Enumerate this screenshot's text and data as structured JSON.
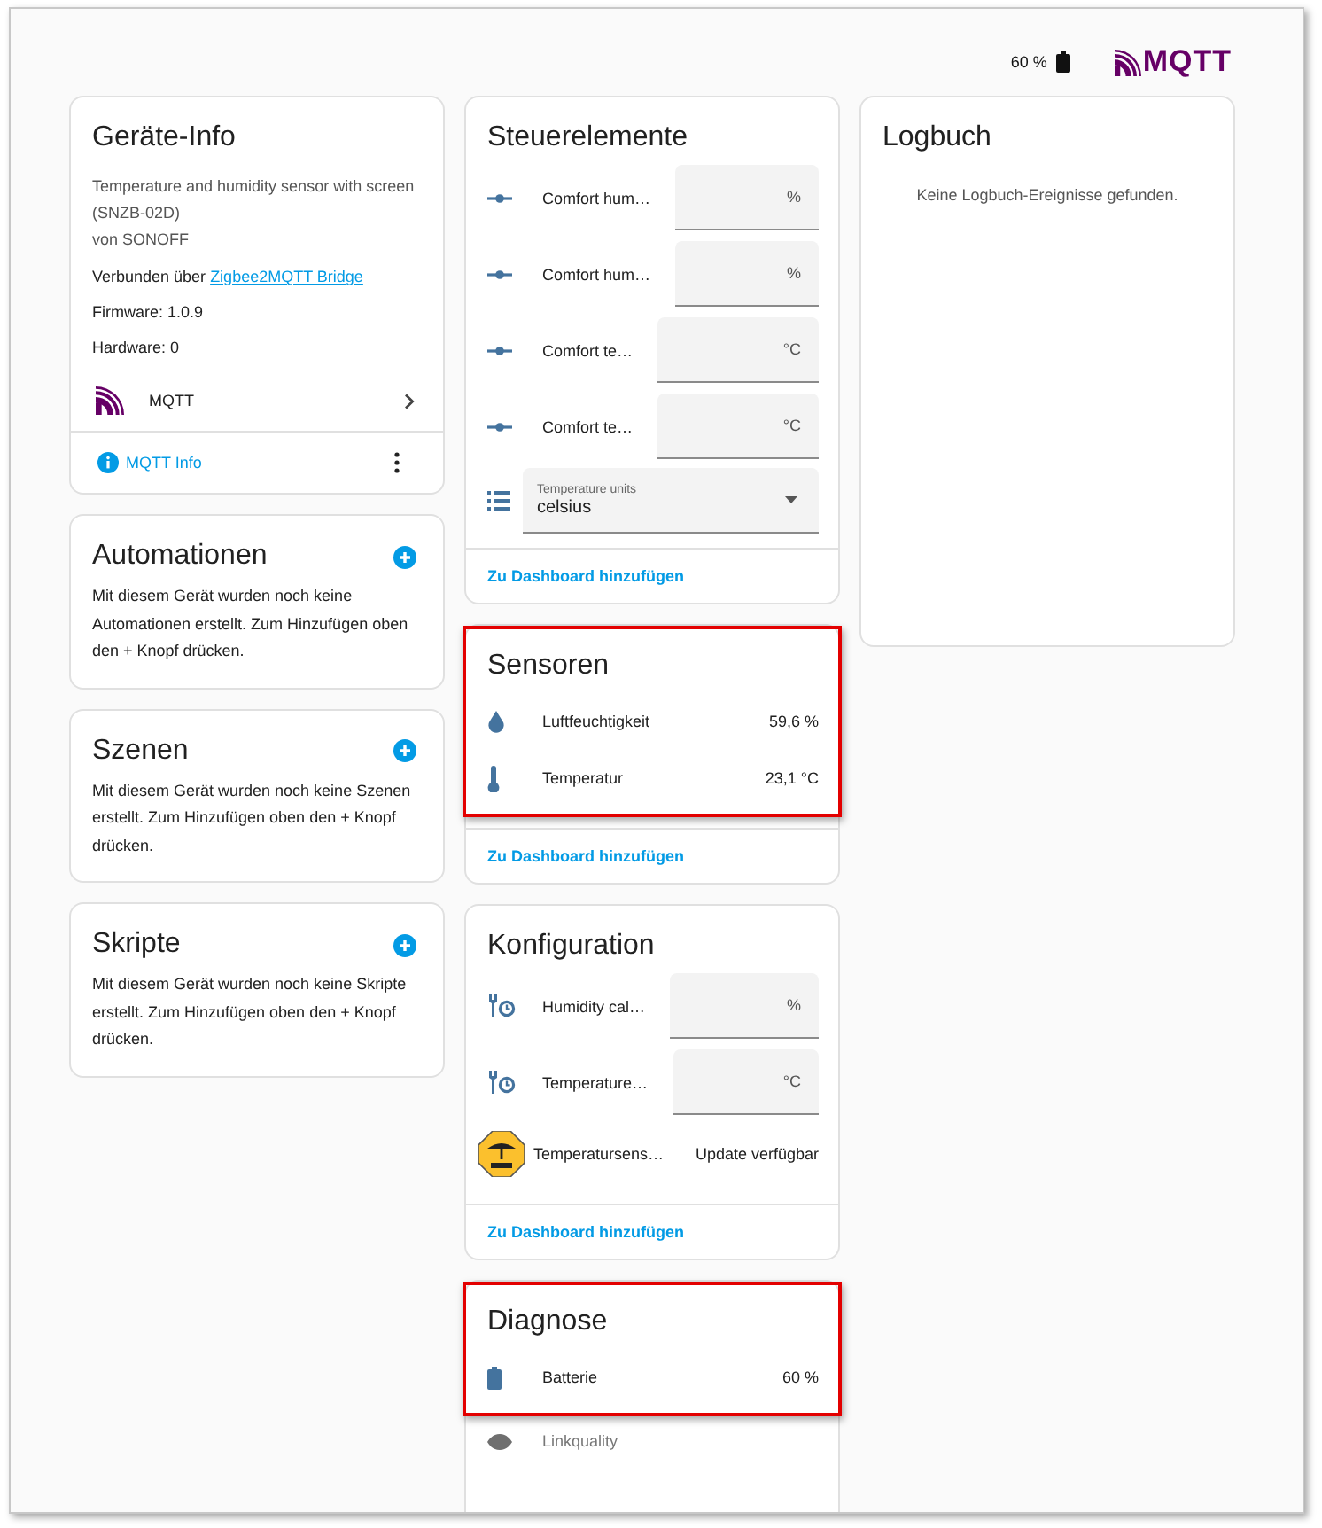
{
  "header": {
    "battery_reading": "60 %",
    "logo_text": "MQTT"
  },
  "device_info": {
    "title": "Geräte-Info",
    "description": "Temperature and humidity sensor with screen (SNZB-02D)",
    "manufacturer": "von SONOFF",
    "connected_prefix": "Verbunden über",
    "connected_link": "Zigbee2MQTT Bridge",
    "firmware": "Firmware: 1.0.9",
    "hardware": "Hardware: 0",
    "integration": "MQTT",
    "info_link": "MQTT Info"
  },
  "related_cards": [
    {
      "title": "Automationen",
      "text": "Mit diesem Gerät wurden noch keine Automationen erstellt. Zum Hinzufügen oben den + Knopf drücken."
    },
    {
      "title": "Szenen",
      "text": "Mit diesem Gerät wurden noch keine Szenen erstellt. Zum Hinzufügen oben den + Knopf drücken."
    },
    {
      "title": "Skripte",
      "text": "Mit diesem Gerät wurden noch keine Skripte erstellt. Zum Hinzufügen oben den + Knopf drücken."
    }
  ],
  "entity_cards": [
    {
      "title": "Steuerelemente",
      "footer": "Zu Dashboard hinzufügen",
      "rows": [
        {
          "kind": "number",
          "name": "Comfort hum…",
          "unit": "%",
          "highlighted": false
        },
        {
          "kind": "number",
          "name": "Comfort hum…",
          "unit": "%",
          "highlighted": false
        },
        {
          "kind": "number",
          "name": "Comfort te…",
          "unit": "°C",
          "highlighted": false
        },
        {
          "kind": "number",
          "name": "Comfort te…",
          "unit": "°C",
          "highlighted": false
        },
        {
          "kind": "select",
          "label": "Temperature units",
          "value": "celsius",
          "highlighted": false
        }
      ]
    },
    {
      "title": "Sensoren",
      "footer": "Zu Dashboard hinzufügen",
      "rows": [
        {
          "kind": "sensor",
          "name": "Luftfeuchtigkeit",
          "value": "59,6 %",
          "dimmed": false,
          "highlighted": true
        },
        {
          "kind": "sensor",
          "name": "Temperatur",
          "value": "23,1 °C",
          "dimmed": false,
          "highlighted": true
        }
      ]
    },
    {
      "title": "Konfiguration",
      "footer": "Zu Dashboard hinzufügen",
      "rows": [
        {
          "kind": "number",
          "name": "Humidity cal…",
          "unit": "%",
          "highlighted": false
        },
        {
          "kind": "number",
          "name": "Temperature…",
          "unit": "°C",
          "highlighted": false
        },
        {
          "kind": "update",
          "name": "Temperatursens…",
          "value": "Update verfügbar",
          "highlighted": false
        }
      ]
    },
    {
      "title": "Diagnose",
      "rows": [
        {
          "kind": "sensor",
          "name": "Batterie",
          "value": "60 %",
          "dimmed": false,
          "highlighted": true
        },
        {
          "kind": "sensor",
          "name": "Linkquality",
          "dimmed": true,
          "highlighted": false
        }
      ]
    }
  ],
  "logbook": {
    "title": "Logbuch",
    "empty_text": "Keine Logbuch-Ereignisse gefunden."
  }
}
